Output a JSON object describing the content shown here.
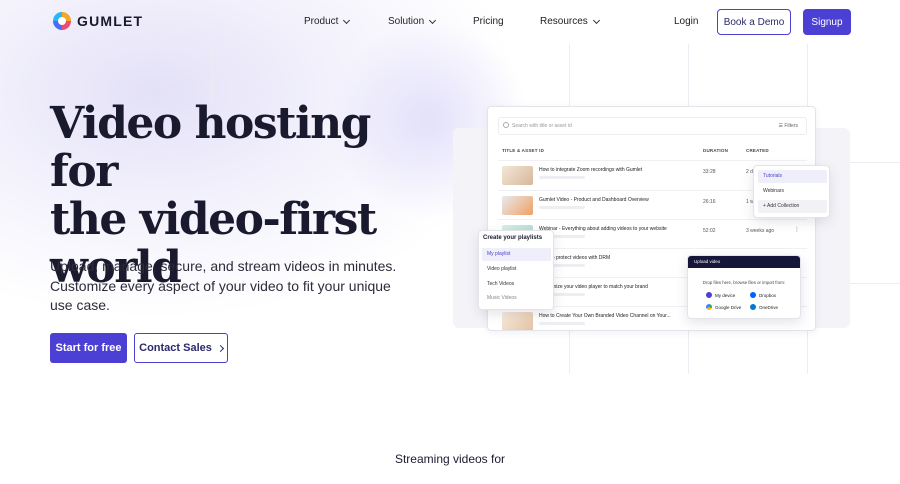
{
  "nav": {
    "logo_text": "GUMLET",
    "items": [
      {
        "label": "Product",
        "dropdown": true
      },
      {
        "label": "Solution",
        "dropdown": true
      },
      {
        "label": "Pricing",
        "dropdown": false
      },
      {
        "label": "Resources",
        "dropdown": true
      }
    ],
    "login": "Login",
    "book_demo": "Book a Demo",
    "signup": "Signup"
  },
  "hero": {
    "title_line1": "Video hosting for",
    "title_line2": "the video-first",
    "title_line3": "world",
    "subtitle": "Upload, manage, secure, and stream videos in minutes. Customize every aspect of your video to fit your unique use case.",
    "cta_primary": "Start for free",
    "cta_secondary": "Contact Sales"
  },
  "dashboard": {
    "search_placeholder": "Search with title or asset id",
    "filters_label": "Filters",
    "columns": {
      "title": "TITLE & ASSET ID",
      "duration": "DURATION",
      "created": "CREATED"
    },
    "rows": [
      {
        "title": "How to integrate Zoom recordings with Gumlet",
        "duration": "33:28",
        "created": "2 d"
      },
      {
        "title": "Gumlet Video - Product and Dashboard Overview",
        "duration": "26:16",
        "created": "1 w"
      },
      {
        "title": "Webinar - Everything about adding videos to your website",
        "duration": "52:02",
        "created": "3 weeks ago"
      },
      {
        "title": "How to protect videos with DRM",
        "duration": "",
        "created": ""
      },
      {
        "title": "Customize your video player to match your brand",
        "duration": "",
        "created": ""
      },
      {
        "title": "How to Create Your Own Branded Video Channel on Your...",
        "duration": "",
        "created": ""
      }
    ],
    "playlists": {
      "title": "Create your playlists",
      "items": [
        "My playlist",
        "Video playlist",
        "Tech Videos",
        "Music Videos"
      ]
    },
    "collections": {
      "items": [
        "Tutorials",
        "Webinars"
      ],
      "add_label": "Add Collection"
    },
    "upload": {
      "header": "Upload video",
      "line": "Drop files here, browse files or import from:",
      "sources": [
        "My device",
        "Dropbox",
        "Google Drive",
        "OneDrive"
      ]
    }
  },
  "footer_teaser": "Streaming videos for",
  "colors": {
    "accent": "#4b3fd4",
    "text": "#1a1a2e",
    "upload_header": "#16163a"
  }
}
